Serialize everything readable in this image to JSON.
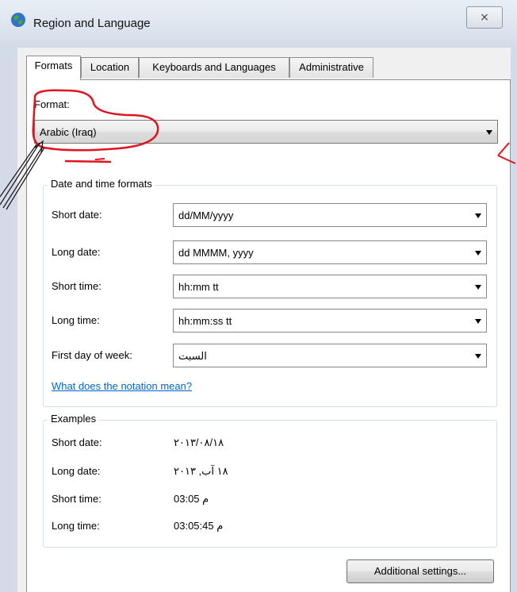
{
  "window": {
    "title": "Region and Language",
    "close_glyph": "⨯"
  },
  "tabs": [
    {
      "label": "Formats",
      "active": true
    },
    {
      "label": "Location",
      "active": false
    },
    {
      "label": "Keyboards and Languages",
      "active": false
    },
    {
      "label": "Administrative",
      "active": false
    }
  ],
  "format": {
    "label": "Format:",
    "value": "Arabic (Iraq)"
  },
  "datetime": {
    "title": "Date and time formats",
    "rows": [
      {
        "label": "Short date:",
        "value": "dd/MM/yyyy"
      },
      {
        "label": "Long date:",
        "value": "dd MMMM, yyyy"
      },
      {
        "label": "Short time:",
        "value": "hh:mm tt"
      },
      {
        "label": "Long time:",
        "value": "hh:mm:ss tt"
      },
      {
        "label": "First day of week:",
        "value": "السبت"
      }
    ],
    "link": "What does the notation mean?"
  },
  "examples": {
    "title": "Examples",
    "rows": [
      {
        "label": "Short date:",
        "value": "٢٠١٣/٠٨/١٨"
      },
      {
        "label": "Long date:",
        "value": "١٨ آب, ٢٠١٣"
      },
      {
        "label": "Short time:",
        "value": "03:05 م"
      },
      {
        "label": "Long time:",
        "value": "03:05:45 م"
      }
    ]
  },
  "buttons": {
    "additional_settings": "Additional settings..."
  },
  "colors": {
    "annotation_red": "#e0141e",
    "link_blue": "#0066cc"
  }
}
